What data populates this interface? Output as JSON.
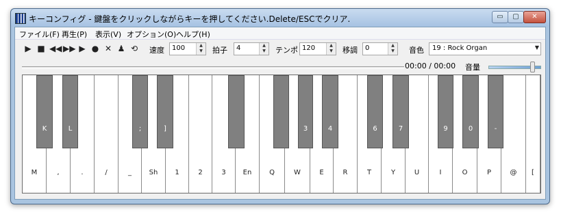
{
  "window": {
    "title": "キーコンフィグ - 鍵盤をクリックしながらキーを押してください.Delete/ESCでクリア.",
    "minimize": "▭",
    "maximize": "▢",
    "close": "✕"
  },
  "menu": [
    "ファイル(F)",
    "再生(P)",
    "表示(V)",
    "オプション(O)",
    "ヘルプ(H)"
  ],
  "toolbar": {
    "icons": [
      "play-icon",
      "stop-icon",
      "rewind-icon",
      "fast-forward-icon",
      "step-play-icon",
      "record-icon",
      "clear-icon",
      "metronome-icon",
      "loop-icon"
    ],
    "speed_label": "速度",
    "speed_value": "100",
    "beat_label": "拍子",
    "beat_value": "4",
    "tempo_label": "テンポ",
    "tempo_value": "120",
    "transpose_label": "移調",
    "transpose_value": "0",
    "tone_label": "音色",
    "tone_value": "19 : Rock Organ"
  },
  "playback": {
    "time": "00:00 / 00:00",
    "volume_label": "音量",
    "volume_level": 0.9
  },
  "keyboard": {
    "white_keys": [
      "M",
      ",",
      ".",
      "/",
      "_",
      "Sh",
      "1",
      "2",
      "3",
      "En",
      "Q",
      "W",
      "E",
      "R",
      "T",
      "Y",
      "U",
      "I",
      "O",
      "P",
      "@",
      "["
    ],
    "black_keys": [
      "K",
      "L",
      ";",
      "]",
      "",
      "",
      "3",
      "4",
      "6",
      "7",
      "9",
      "0",
      "-"
    ]
  }
}
